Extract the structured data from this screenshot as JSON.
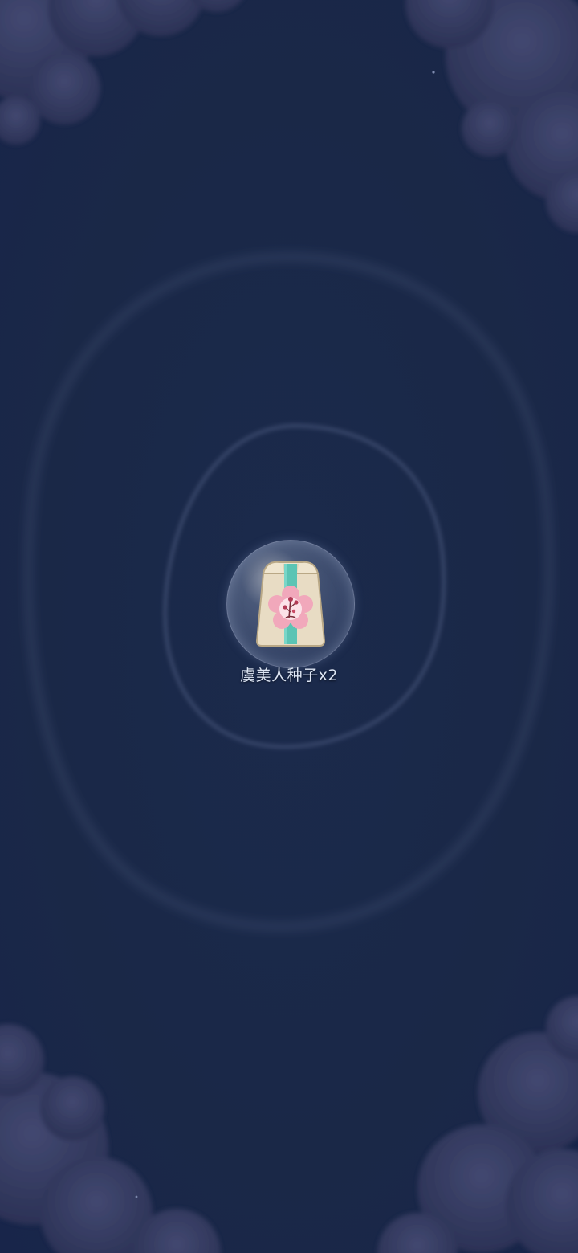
{
  "scene": {
    "background_color": "#1a2848",
    "cloud_color": "#3a3f66"
  },
  "reward": {
    "item_name": "虞美人种子x2",
    "icon": "seed-packet-icon",
    "bubble_color": "#8a98bd",
    "packet_color": "#e8dcc4",
    "band_color": "#5bc4b4",
    "flower_badge_color": "#f1a8bb"
  }
}
